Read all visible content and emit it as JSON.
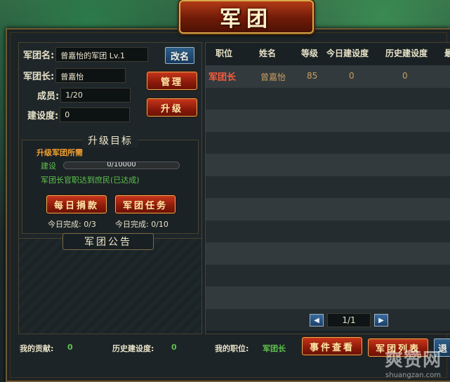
{
  "window": {
    "title": "军团"
  },
  "info": {
    "name_label": "军团名:",
    "name_value": "曾嘉怡的军团 Lv.1",
    "rename_button": "改名",
    "leader_label": "军团长:",
    "leader_value": "曾嘉怡",
    "manage_button": "管理",
    "members_label": "成员:",
    "members_value": "1/20",
    "upgrade_button": "升级",
    "build_label": "建设度:",
    "build_value": "0"
  },
  "upgrade": {
    "section_title": "升级目标",
    "requirement_title": "升级军团所需",
    "build_label": "建设",
    "progress_text": "0/10000",
    "progress_fraction": 0,
    "rank_requirement": "军团长官职达到庶民(已达成)",
    "daily_donate_button": "每日捐款",
    "daily_donate_status": "今日完成:  0/3",
    "legion_task_button": "军团任务",
    "legion_task_status": "今日完成:  0/10"
  },
  "notice": {
    "title": "军团公告"
  },
  "table": {
    "columns": [
      "职位",
      "姓名",
      "等级",
      "今日建设度",
      "历史建设度",
      "最"
    ],
    "rows": [
      {
        "position": "军团长",
        "name": "曾嘉怡",
        "level": "85",
        "today_build": "0",
        "history_build": "0"
      }
    ],
    "empty_rows": 11
  },
  "pager": {
    "prev_icon": "prev-page-icon",
    "next_icon": "next-page-icon",
    "page_text": "1/1"
  },
  "footer": {
    "contribution_label": "我的贡献:",
    "contribution_value": "0",
    "history_build_label": "历史建设度:",
    "history_build_value": "0",
    "my_position_label": "我的职位:",
    "my_position_value": "军团长",
    "event_button": "事件查看",
    "legion_list_button": "军团列表",
    "exit_button": "退"
  },
  "watermark": {
    "main": "爽赞网",
    "sub": "shuangzan.com"
  },
  "colors": {
    "accent_red": "#b23a16",
    "gold_border": "#d8a94a",
    "highlight_green": "#5fc24e",
    "position_red": "#ff5a3a"
  }
}
